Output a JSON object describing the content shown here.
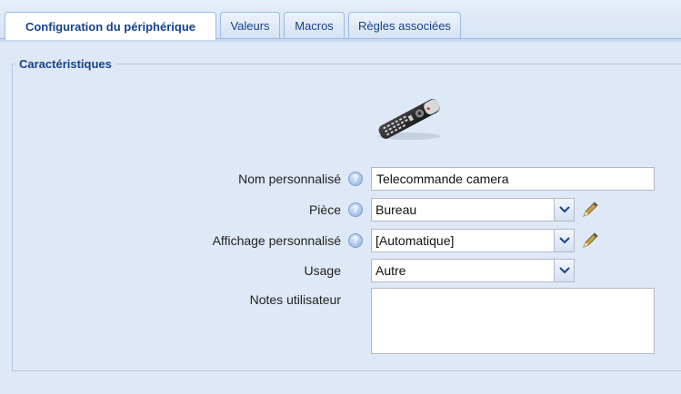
{
  "tabs": [
    {
      "label": "Configuration du périphérique",
      "active": true
    },
    {
      "label": "Valeurs",
      "active": false
    },
    {
      "label": "Macros",
      "active": false
    },
    {
      "label": "Règles associées",
      "active": false
    }
  ],
  "section": {
    "legend": "Caractéristiques",
    "device_icon": "remote-control-icon"
  },
  "form": {
    "name": {
      "label": "Nom personnalisé",
      "value": "Telecommande camera"
    },
    "room": {
      "label": "Pièce",
      "value": "Bureau"
    },
    "display": {
      "label": "Affichage personnalisé",
      "value": "[Automatique]"
    },
    "usage": {
      "label": "Usage",
      "value": "Autre"
    },
    "notes": {
      "label": "Notes utilisateur",
      "value": ""
    }
  },
  "colors": {
    "accent": "#15428b",
    "border": "#99bbe8",
    "background": "#dfe8f6"
  }
}
